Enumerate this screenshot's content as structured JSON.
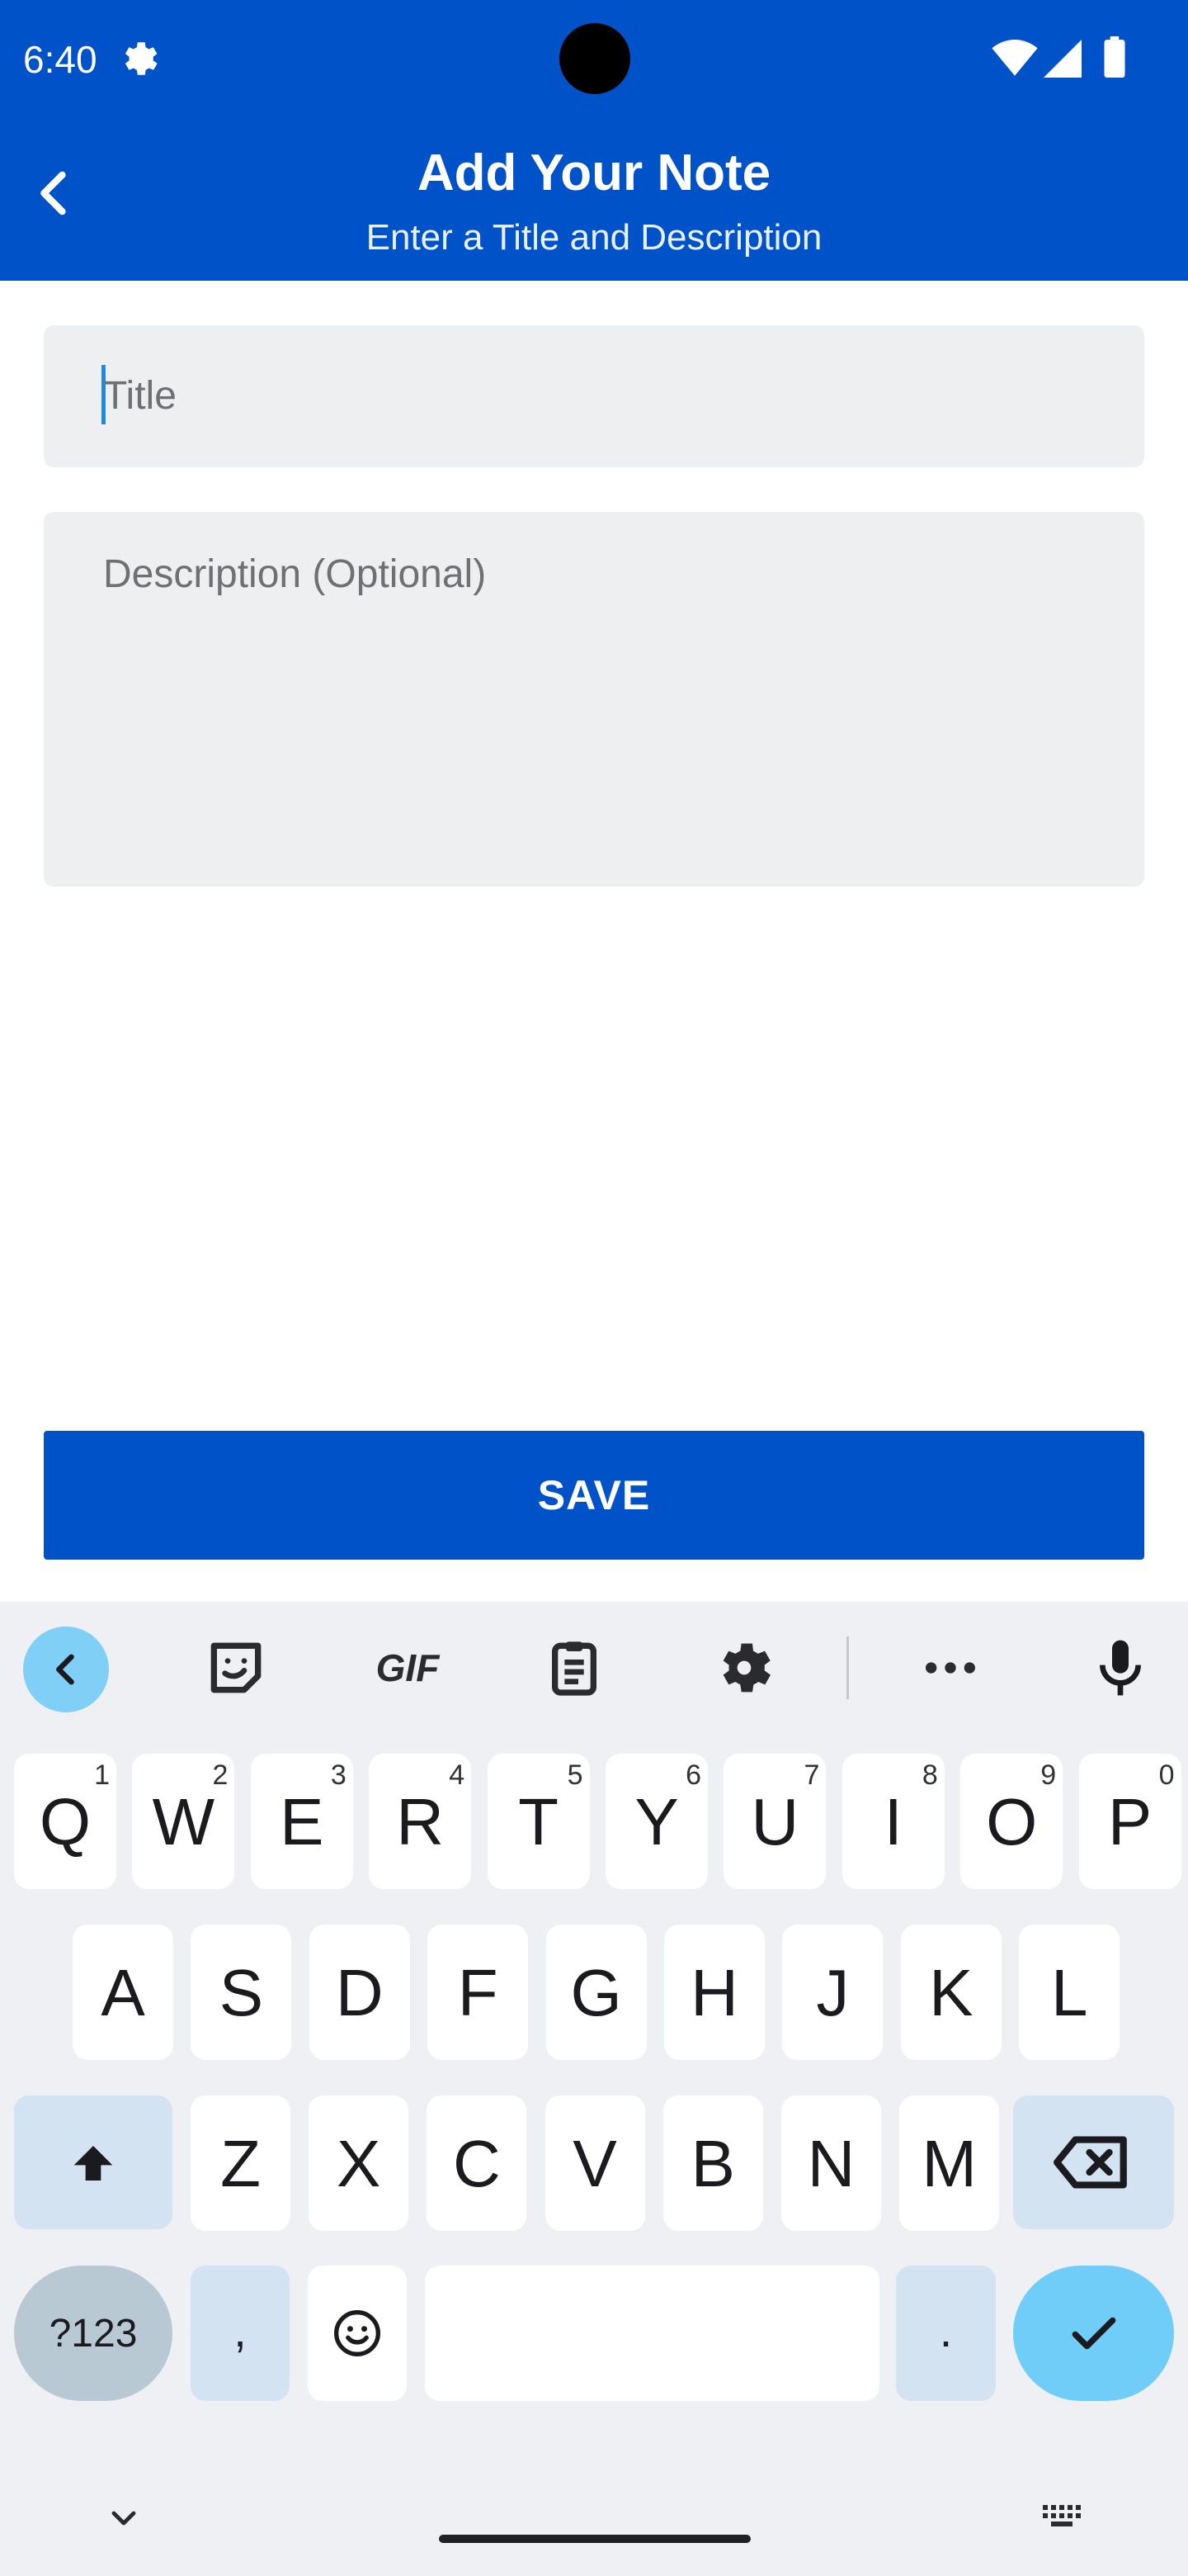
{
  "status_bar": {
    "time": "6:40",
    "icons": [
      "settings-gear-icon",
      "wifi-icon",
      "cell-signal-icon",
      "battery-icon"
    ]
  },
  "header": {
    "title": "Add Your Note",
    "subtitle": "Enter a Title and Description",
    "back_icon": "chevron-left-icon",
    "background_color": "#0052c9"
  },
  "form": {
    "title_placeholder": "Title",
    "description_placeholder": "Description (Optional)",
    "save_label": "SAVE"
  },
  "keyboard": {
    "toolbar": [
      "chevron-left-icon",
      "sticker-icon",
      "gif-icon",
      "clipboard-icon",
      "settings-icon",
      "more-icon",
      "microphone-icon"
    ],
    "gif_label": "GIF",
    "row1": [
      {
        "key": "Q",
        "hint": "1"
      },
      {
        "key": "W",
        "hint": "2"
      },
      {
        "key": "E",
        "hint": "3"
      },
      {
        "key": "R",
        "hint": "4"
      },
      {
        "key": "T",
        "hint": "5"
      },
      {
        "key": "Y",
        "hint": "6"
      },
      {
        "key": "U",
        "hint": "7"
      },
      {
        "key": "I",
        "hint": "8"
      },
      {
        "key": "O",
        "hint": "9"
      },
      {
        "key": "P",
        "hint": "0"
      }
    ],
    "row2": [
      "A",
      "S",
      "D",
      "F",
      "G",
      "H",
      "J",
      "K",
      "L"
    ],
    "row3": [
      "Z",
      "X",
      "C",
      "V",
      "B",
      "N",
      "M"
    ],
    "symbols_label": "?123",
    "comma": ",",
    "period": ".",
    "accent_color": "#6fcdf8"
  }
}
